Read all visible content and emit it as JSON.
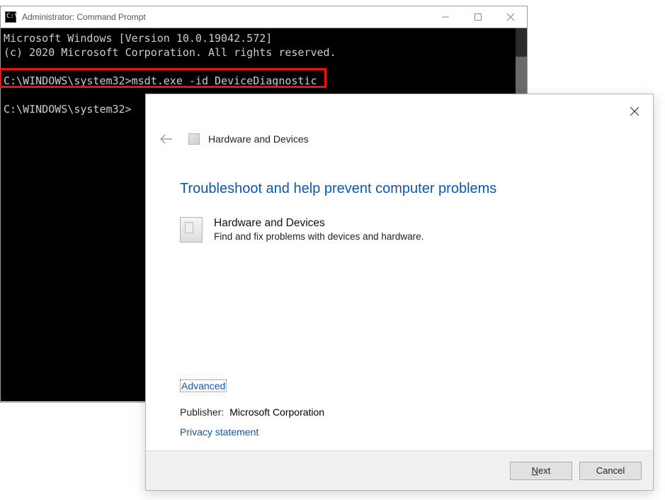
{
  "cmd": {
    "title": "Administrator: Command Prompt",
    "line1": "Microsoft Windows [Version 10.0.19042.572]",
    "line2": "(c) 2020 Microsoft Corporation. All rights reserved.",
    "prompt1": "C:\\WINDOWS\\system32>",
    "command": "msdt.exe -id DeviceDiagnostic",
    "prompt2": "C:\\WINDOWS\\system32>"
  },
  "ts": {
    "header_title": "Hardware and Devices",
    "heading": "Troubleshoot and help prevent computer problems",
    "item_title": "Hardware and Devices",
    "item_desc": "Find and fix problems with devices and hardware.",
    "advanced": "Advanced",
    "publisher_label": "Publisher:",
    "publisher_value": "Microsoft Corporation",
    "privacy": "Privacy statement",
    "next_pre": "",
    "next_u": "N",
    "next_post": "ext",
    "cancel": "Cancel"
  }
}
